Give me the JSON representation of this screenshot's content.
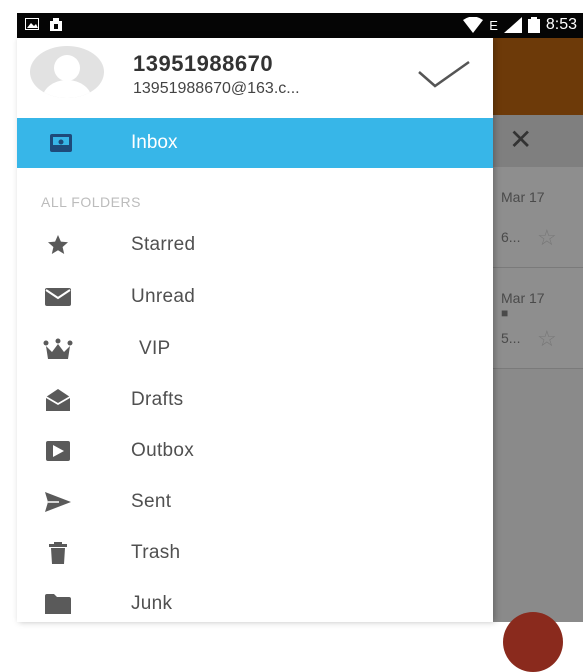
{
  "status_bar": {
    "time": "8:53",
    "network": "E"
  },
  "account": {
    "name": "13951988670",
    "email": "13951988670@163.c..."
  },
  "drawer": {
    "selected": {
      "label": "Inbox",
      "icon": "inbox-icon"
    },
    "section_title": "ALL FOLDERS",
    "folders": [
      {
        "label": "Starred",
        "icon": "star-icon"
      },
      {
        "label": "Unread",
        "icon": "envelope-icon"
      },
      {
        "label": "VIP",
        "icon": "crown-icon"
      },
      {
        "label": "Drafts",
        "icon": "open-envelope-icon"
      },
      {
        "label": "Outbox",
        "icon": "outbox-icon"
      },
      {
        "label": "Sent",
        "icon": "send-icon"
      },
      {
        "label": "Trash",
        "icon": "trash-icon"
      },
      {
        "label": "Junk",
        "icon": "folder-icon"
      }
    ]
  },
  "background_list": [
    {
      "date": "Mar 17",
      "snippet": "6..."
    },
    {
      "date": "Mar 17",
      "snippet": "5..."
    }
  ],
  "colors": {
    "accent": "#37b6e8",
    "toolbar": "#6d3a09",
    "text": "#505050"
  }
}
